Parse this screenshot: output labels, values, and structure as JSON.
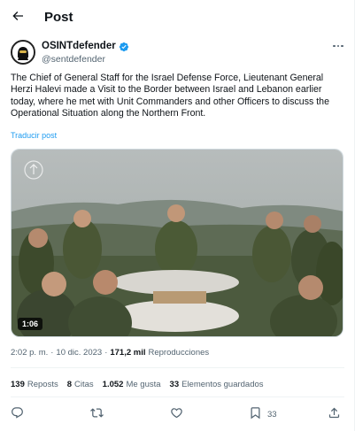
{
  "header": {
    "title": "Post"
  },
  "author": {
    "name": "OSINTdefender",
    "handle": "@sentdefender"
  },
  "tweet": {
    "text": "The Chief of General Staff for the Israel Defense Force, Lieutenant General Herzi Halevi made a Visit to the Border between Israel and Lebanon earlier today, where he met with Unit Commanders and other Officers to discuss the Operational Situation along the Northern Front.",
    "translate_label": "Traducir post"
  },
  "media": {
    "duration": "1:06"
  },
  "meta": {
    "time": "2:02 p. m.",
    "separator": "·",
    "date": "10 dic. 2023",
    "views_count": "171,2 mil",
    "views_label": "Reproducciones"
  },
  "stats": {
    "reposts_count": "139",
    "reposts_label": "Reposts",
    "quotes_count": "8",
    "quotes_label": "Citas",
    "likes_count": "1.052",
    "likes_label": "Me gusta",
    "bookmarks_count": "33",
    "bookmarks_label": "Elementos guardados"
  },
  "actions": {
    "bookmark_count": "33"
  },
  "icons": {
    "back": "arrow-left-icon",
    "verified": "verified-badge-icon",
    "more": "more-icon",
    "reply": "reply-icon",
    "repost": "repost-icon",
    "like": "like-icon",
    "bookmark": "bookmark-icon",
    "share": "share-icon"
  },
  "colors": {
    "accent": "#1d9bf0",
    "text": "#0f1419",
    "secondary": "#536471"
  }
}
